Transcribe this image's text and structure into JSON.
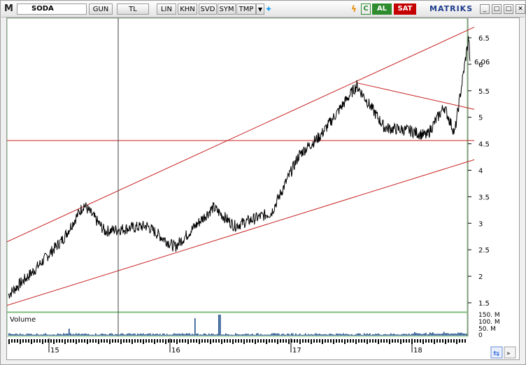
{
  "toolbar": {
    "symbol": "SODA",
    "period": "GUN",
    "currency": "TL",
    "scale": "LIN",
    "buttons": [
      "KHN",
      "SVD",
      "SYM",
      "TMP"
    ],
    "buy_label": "AL",
    "sell_label": "SAT",
    "brand": "MATRIKS"
  },
  "chart_data": {
    "type": "line",
    "title": "",
    "ylabel": "",
    "xlabel": "",
    "ylim": [
      1.35,
      6.75
    ],
    "x_ticks": [
      "15",
      "16",
      "17",
      "18"
    ],
    "y_ticks": [
      1.5,
      2,
      2.5,
      3,
      3.5,
      4,
      4.5,
      5,
      5.5,
      6,
      6.5
    ],
    "last_price": "6.06",
    "price_series_approx": [
      {
        "x": "2015-01",
        "y": 1.65
      },
      {
        "x": "2015-04",
        "y": 2.1
      },
      {
        "x": "2015-07",
        "y": 2.7
      },
      {
        "x": "2015-09",
        "y": 3.35
      },
      {
        "x": "2015-11",
        "y": 2.85
      },
      {
        "x": "2016-03",
        "y": 2.95
      },
      {
        "x": "2016-05",
        "y": 2.55
      },
      {
        "x": "2016-09",
        "y": 3.3
      },
      {
        "x": "2016-11",
        "y": 2.95
      },
      {
        "x": "2017-01",
        "y": 3.2
      },
      {
        "x": "2017-03",
        "y": 4.3
      },
      {
        "x": "2017-05",
        "y": 4.65
      },
      {
        "x": "2017-08",
        "y": 5.6
      },
      {
        "x": "2017-10",
        "y": 4.8
      },
      {
        "x": "2018-01",
        "y": 4.75
      },
      {
        "x": "2018-04",
        "y": 4.65
      },
      {
        "x": "2018-06",
        "y": 5.2
      },
      {
        "x": "2018-07",
        "y": 4.7
      },
      {
        "x": "2018-08",
        "y": 6.5
      },
      {
        "x": "2018-08-end",
        "y": 6.06
      }
    ],
    "volume": {
      "label": "Volume",
      "ticks": [
        "150. M",
        "100. M",
        "50. M",
        "0"
      ]
    }
  }
}
